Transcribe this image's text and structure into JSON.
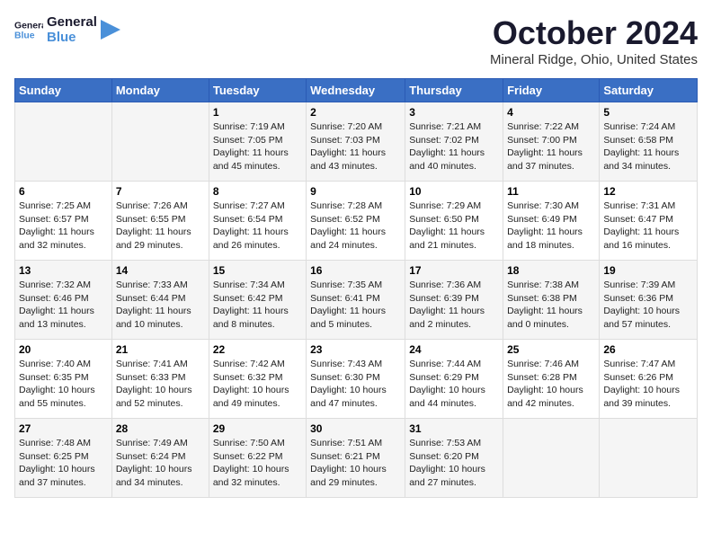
{
  "header": {
    "logo_line1": "General",
    "logo_line2": "Blue",
    "month_title": "October 2024",
    "location": "Mineral Ridge, Ohio, United States"
  },
  "weekdays": [
    "Sunday",
    "Monday",
    "Tuesday",
    "Wednesday",
    "Thursday",
    "Friday",
    "Saturday"
  ],
  "weeks": [
    [
      {
        "day": "",
        "sunrise": "",
        "sunset": "",
        "daylight": ""
      },
      {
        "day": "",
        "sunrise": "",
        "sunset": "",
        "daylight": ""
      },
      {
        "day": "1",
        "sunrise": "Sunrise: 7:19 AM",
        "sunset": "Sunset: 7:05 PM",
        "daylight": "Daylight: 11 hours and 45 minutes."
      },
      {
        "day": "2",
        "sunrise": "Sunrise: 7:20 AM",
        "sunset": "Sunset: 7:03 PM",
        "daylight": "Daylight: 11 hours and 43 minutes."
      },
      {
        "day": "3",
        "sunrise": "Sunrise: 7:21 AM",
        "sunset": "Sunset: 7:02 PM",
        "daylight": "Daylight: 11 hours and 40 minutes."
      },
      {
        "day": "4",
        "sunrise": "Sunrise: 7:22 AM",
        "sunset": "Sunset: 7:00 PM",
        "daylight": "Daylight: 11 hours and 37 minutes."
      },
      {
        "day": "5",
        "sunrise": "Sunrise: 7:24 AM",
        "sunset": "Sunset: 6:58 PM",
        "daylight": "Daylight: 11 hours and 34 minutes."
      }
    ],
    [
      {
        "day": "6",
        "sunrise": "Sunrise: 7:25 AM",
        "sunset": "Sunset: 6:57 PM",
        "daylight": "Daylight: 11 hours and 32 minutes."
      },
      {
        "day": "7",
        "sunrise": "Sunrise: 7:26 AM",
        "sunset": "Sunset: 6:55 PM",
        "daylight": "Daylight: 11 hours and 29 minutes."
      },
      {
        "day": "8",
        "sunrise": "Sunrise: 7:27 AM",
        "sunset": "Sunset: 6:54 PM",
        "daylight": "Daylight: 11 hours and 26 minutes."
      },
      {
        "day": "9",
        "sunrise": "Sunrise: 7:28 AM",
        "sunset": "Sunset: 6:52 PM",
        "daylight": "Daylight: 11 hours and 24 minutes."
      },
      {
        "day": "10",
        "sunrise": "Sunrise: 7:29 AM",
        "sunset": "Sunset: 6:50 PM",
        "daylight": "Daylight: 11 hours and 21 minutes."
      },
      {
        "day": "11",
        "sunrise": "Sunrise: 7:30 AM",
        "sunset": "Sunset: 6:49 PM",
        "daylight": "Daylight: 11 hours and 18 minutes."
      },
      {
        "day": "12",
        "sunrise": "Sunrise: 7:31 AM",
        "sunset": "Sunset: 6:47 PM",
        "daylight": "Daylight: 11 hours and 16 minutes."
      }
    ],
    [
      {
        "day": "13",
        "sunrise": "Sunrise: 7:32 AM",
        "sunset": "Sunset: 6:46 PM",
        "daylight": "Daylight: 11 hours and 13 minutes."
      },
      {
        "day": "14",
        "sunrise": "Sunrise: 7:33 AM",
        "sunset": "Sunset: 6:44 PM",
        "daylight": "Daylight: 11 hours and 10 minutes."
      },
      {
        "day": "15",
        "sunrise": "Sunrise: 7:34 AM",
        "sunset": "Sunset: 6:42 PM",
        "daylight": "Daylight: 11 hours and 8 minutes."
      },
      {
        "day": "16",
        "sunrise": "Sunrise: 7:35 AM",
        "sunset": "Sunset: 6:41 PM",
        "daylight": "Daylight: 11 hours and 5 minutes."
      },
      {
        "day": "17",
        "sunrise": "Sunrise: 7:36 AM",
        "sunset": "Sunset: 6:39 PM",
        "daylight": "Daylight: 11 hours and 2 minutes."
      },
      {
        "day": "18",
        "sunrise": "Sunrise: 7:38 AM",
        "sunset": "Sunset: 6:38 PM",
        "daylight": "Daylight: 11 hours and 0 minutes."
      },
      {
        "day": "19",
        "sunrise": "Sunrise: 7:39 AM",
        "sunset": "Sunset: 6:36 PM",
        "daylight": "Daylight: 10 hours and 57 minutes."
      }
    ],
    [
      {
        "day": "20",
        "sunrise": "Sunrise: 7:40 AM",
        "sunset": "Sunset: 6:35 PM",
        "daylight": "Daylight: 10 hours and 55 minutes."
      },
      {
        "day": "21",
        "sunrise": "Sunrise: 7:41 AM",
        "sunset": "Sunset: 6:33 PM",
        "daylight": "Daylight: 10 hours and 52 minutes."
      },
      {
        "day": "22",
        "sunrise": "Sunrise: 7:42 AM",
        "sunset": "Sunset: 6:32 PM",
        "daylight": "Daylight: 10 hours and 49 minutes."
      },
      {
        "day": "23",
        "sunrise": "Sunrise: 7:43 AM",
        "sunset": "Sunset: 6:30 PM",
        "daylight": "Daylight: 10 hours and 47 minutes."
      },
      {
        "day": "24",
        "sunrise": "Sunrise: 7:44 AM",
        "sunset": "Sunset: 6:29 PM",
        "daylight": "Daylight: 10 hours and 44 minutes."
      },
      {
        "day": "25",
        "sunrise": "Sunrise: 7:46 AM",
        "sunset": "Sunset: 6:28 PM",
        "daylight": "Daylight: 10 hours and 42 minutes."
      },
      {
        "day": "26",
        "sunrise": "Sunrise: 7:47 AM",
        "sunset": "Sunset: 6:26 PM",
        "daylight": "Daylight: 10 hours and 39 minutes."
      }
    ],
    [
      {
        "day": "27",
        "sunrise": "Sunrise: 7:48 AM",
        "sunset": "Sunset: 6:25 PM",
        "daylight": "Daylight: 10 hours and 37 minutes."
      },
      {
        "day": "28",
        "sunrise": "Sunrise: 7:49 AM",
        "sunset": "Sunset: 6:24 PM",
        "daylight": "Daylight: 10 hours and 34 minutes."
      },
      {
        "day": "29",
        "sunrise": "Sunrise: 7:50 AM",
        "sunset": "Sunset: 6:22 PM",
        "daylight": "Daylight: 10 hours and 32 minutes."
      },
      {
        "day": "30",
        "sunrise": "Sunrise: 7:51 AM",
        "sunset": "Sunset: 6:21 PM",
        "daylight": "Daylight: 10 hours and 29 minutes."
      },
      {
        "day": "31",
        "sunrise": "Sunrise: 7:53 AM",
        "sunset": "Sunset: 6:20 PM",
        "daylight": "Daylight: 10 hours and 27 minutes."
      },
      {
        "day": "",
        "sunrise": "",
        "sunset": "",
        "daylight": ""
      },
      {
        "day": "",
        "sunrise": "",
        "sunset": "",
        "daylight": ""
      }
    ]
  ]
}
